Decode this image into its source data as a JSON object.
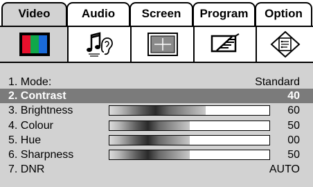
{
  "tabs": [
    {
      "label": "Video",
      "active": true
    },
    {
      "label": "Audio",
      "active": false
    },
    {
      "label": "Screen",
      "active": false
    },
    {
      "label": "Program",
      "active": false
    },
    {
      "label": "Option",
      "active": false
    }
  ],
  "icons": [
    "tv-color-bars-icon",
    "music-note-ear-icon",
    "screen-crosshair-icon",
    "antenna-icon",
    "option-diamond-icon"
  ],
  "menu": {
    "items": [
      {
        "label": "1. Mode:",
        "value": "Standard"
      },
      {
        "label": "2. Contrast",
        "value": "40",
        "selected": true
      },
      {
        "label": "3. Brightness",
        "value": "60",
        "level": 0.6
      },
      {
        "label": "4. Colour",
        "value": "50",
        "level": 0.5
      },
      {
        "label": "5. Hue",
        "value": "00",
        "level": 0.5
      },
      {
        "label": "6. Sharpness",
        "value": "50",
        "level": 0.5
      },
      {
        "label": "7. DNR",
        "value": "AUTO"
      }
    ]
  },
  "colors": {
    "panel_bg": "#d2d2d2",
    "highlight_bg": "#7b7b7b",
    "tv_red": "#e8102c",
    "tv_green": "#10a84a",
    "tv_blue": "#1a6ad8"
  }
}
